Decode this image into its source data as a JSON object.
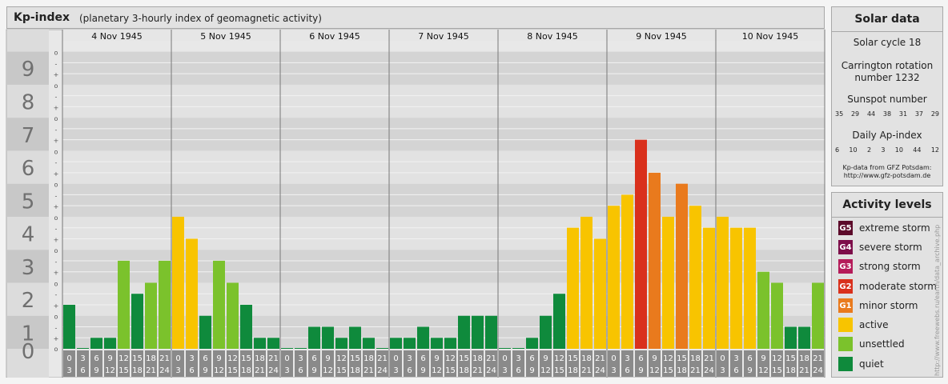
{
  "header": {
    "title": "Kp-index",
    "subtitle": "(planetary 3-hourly index of geomagnetic activity)"
  },
  "solar": {
    "title": "Solar data",
    "cycle": "Solar cycle 18",
    "carrington_line1": "Carrington rotation",
    "carrington_line2": "number 1232",
    "sunspot_title": "Sunspot number",
    "sunspot_values": [
      "35",
      "29",
      "44",
      "38",
      "31",
      "37",
      "29"
    ],
    "ap_title": "Daily Ap-index",
    "ap_values": [
      "6",
      "10",
      "2",
      "3",
      "10",
      "44",
      "12"
    ],
    "source_line1": "Kp-data from GFZ Potsdam:",
    "source_line2": "http://www.gfz-potsdam.de"
  },
  "levels": {
    "title": "Activity levels",
    "items": [
      {
        "badge": "G5",
        "label": "extreme storm",
        "color": "#5c0a2a"
      },
      {
        "badge": "G4",
        "label": "severe storm",
        "color": "#7d0e4a"
      },
      {
        "badge": "G3",
        "label": "strong storm",
        "color": "#b51c5a"
      },
      {
        "badge": "G2",
        "label": "moderate storm",
        "color": "#d9301c"
      },
      {
        "badge": "G1",
        "label": "minor storm",
        "color": "#e97a1d"
      },
      {
        "badge": "",
        "label": "active",
        "color": "#f8c400"
      },
      {
        "badge": "",
        "label": "unsettled",
        "color": "#7bc22c"
      },
      {
        "badge": "",
        "label": "quiet",
        "color": "#0f8a3c"
      }
    ]
  },
  "watermark": "http://www.freewebs.ru/earth/data_archive.php",
  "chart_data": {
    "type": "bar",
    "title": "Kp-index",
    "days": [
      "4 Nov 1945",
      "5 Nov 1945",
      "6 Nov 1945",
      "7 Nov 1945",
      "8 Nov 1945",
      "9 Nov 1945",
      "10 Nov 1945"
    ],
    "hour_starts": [
      "0",
      "3",
      "6",
      "9",
      "12",
      "15",
      "18",
      "21"
    ],
    "hour_ends": [
      "3",
      "6",
      "9",
      "12",
      "15",
      "18",
      "21",
      "24"
    ],
    "y_ticks": [
      "0",
      "1",
      "2",
      "3",
      "4",
      "5",
      "6",
      "7",
      "8",
      "9"
    ],
    "ylim": [
      0,
      9.33
    ],
    "values": [
      1.333,
      0.0,
      0.333,
      0.333,
      2.667,
      1.667,
      2.0,
      2.667,
      4.0,
      3.333,
      1.0,
      2.667,
      2.0,
      1.333,
      0.333,
      0.333,
      0.0,
      0.0,
      0.667,
      0.667,
      0.333,
      0.667,
      0.333,
      0.0,
      0.333,
      0.333,
      0.667,
      0.333,
      0.333,
      1.0,
      1.0,
      1.0,
      0.0,
      0.0,
      0.333,
      1.0,
      1.667,
      3.667,
      4.0,
      3.333,
      4.333,
      4.667,
      6.333,
      5.333,
      4.0,
      5.0,
      4.333,
      3.667,
      4.0,
      3.667,
      3.667,
      2.333,
      2.0,
      0.667,
      0.667,
      2.0
    ],
    "colors": {
      "quiet": "#0f8a3c",
      "unsettled": "#7bc22c",
      "active": "#f8c400",
      "minor": "#e97a1d",
      "moderate": "#d9301c"
    },
    "grid": true
  }
}
